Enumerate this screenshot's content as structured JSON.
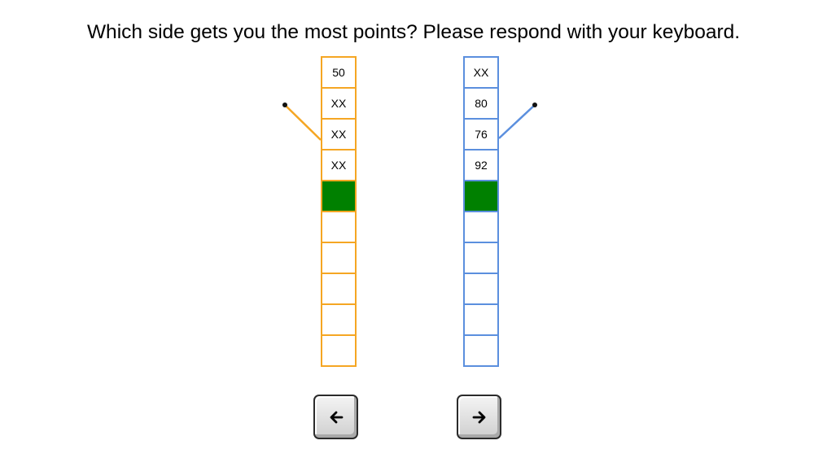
{
  "prompt": "Which side gets you the most points? Please respond with your keyboard.",
  "colors": {
    "left_column": "#f5a623",
    "right_column": "#5b8fde",
    "filled_cell": "#008000",
    "cursor_dot": "#111111"
  },
  "left_column": {
    "cells": [
      "50",
      "XX",
      "XX",
      "XX",
      "",
      "",
      "",
      "",
      "",
      ""
    ],
    "filled_index": 4
  },
  "right_column": {
    "cells": [
      "XX",
      "80",
      "76",
      "92",
      "",
      "",
      "",
      "",
      "",
      ""
    ],
    "filled_index": 4
  },
  "buttons": {
    "left": {
      "icon": "left-arrow-icon",
      "key": "ArrowLeft"
    },
    "right": {
      "icon": "right-arrow-icon",
      "key": "ArrowRight"
    }
  }
}
